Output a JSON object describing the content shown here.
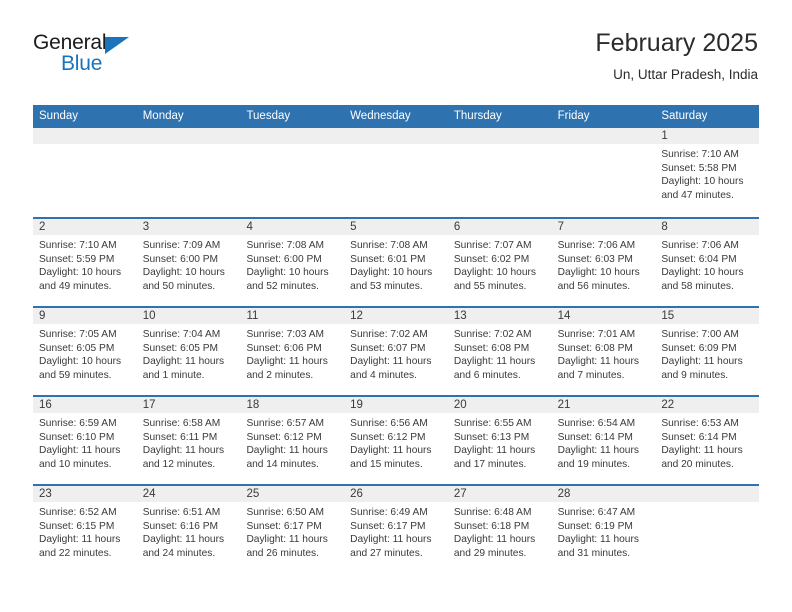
{
  "brand": {
    "name_part1": "General",
    "name_part2": "Blue",
    "triangle_color": "#1b73bb"
  },
  "header": {
    "title": "February 2025",
    "location": "Un, Uttar Pradesh, India"
  },
  "theme": {
    "header_blue": "#2e72b0",
    "day_head_gray": "#efefef",
    "text": "#3a3a3a"
  },
  "weekdays": [
    "Sunday",
    "Monday",
    "Tuesday",
    "Wednesday",
    "Thursday",
    "Friday",
    "Saturday"
  ],
  "weeks": [
    [
      {
        "date": "",
        "empty": true
      },
      {
        "date": "",
        "empty": true
      },
      {
        "date": "",
        "empty": true
      },
      {
        "date": "",
        "empty": true
      },
      {
        "date": "",
        "empty": true
      },
      {
        "date": "",
        "empty": true
      },
      {
        "date": "1",
        "sunrise": "Sunrise: 7:10 AM",
        "sunset": "Sunset: 5:58 PM",
        "daylight": "Daylight: 10 hours and 47 minutes."
      }
    ],
    [
      {
        "date": "2",
        "sunrise": "Sunrise: 7:10 AM",
        "sunset": "Sunset: 5:59 PM",
        "daylight": "Daylight: 10 hours and 49 minutes."
      },
      {
        "date": "3",
        "sunrise": "Sunrise: 7:09 AM",
        "sunset": "Sunset: 6:00 PM",
        "daylight": "Daylight: 10 hours and 50 minutes."
      },
      {
        "date": "4",
        "sunrise": "Sunrise: 7:08 AM",
        "sunset": "Sunset: 6:00 PM",
        "daylight": "Daylight: 10 hours and 52 minutes."
      },
      {
        "date": "5",
        "sunrise": "Sunrise: 7:08 AM",
        "sunset": "Sunset: 6:01 PM",
        "daylight": "Daylight: 10 hours and 53 minutes."
      },
      {
        "date": "6",
        "sunrise": "Sunrise: 7:07 AM",
        "sunset": "Sunset: 6:02 PM",
        "daylight": "Daylight: 10 hours and 55 minutes."
      },
      {
        "date": "7",
        "sunrise": "Sunrise: 7:06 AM",
        "sunset": "Sunset: 6:03 PM",
        "daylight": "Daylight: 10 hours and 56 minutes."
      },
      {
        "date": "8",
        "sunrise": "Sunrise: 7:06 AM",
        "sunset": "Sunset: 6:04 PM",
        "daylight": "Daylight: 10 hours and 58 minutes."
      }
    ],
    [
      {
        "date": "9",
        "sunrise": "Sunrise: 7:05 AM",
        "sunset": "Sunset: 6:05 PM",
        "daylight": "Daylight: 10 hours and 59 minutes."
      },
      {
        "date": "10",
        "sunrise": "Sunrise: 7:04 AM",
        "sunset": "Sunset: 6:05 PM",
        "daylight": "Daylight: 11 hours and 1 minute."
      },
      {
        "date": "11",
        "sunrise": "Sunrise: 7:03 AM",
        "sunset": "Sunset: 6:06 PM",
        "daylight": "Daylight: 11 hours and 2 minutes."
      },
      {
        "date": "12",
        "sunrise": "Sunrise: 7:02 AM",
        "sunset": "Sunset: 6:07 PM",
        "daylight": "Daylight: 11 hours and 4 minutes."
      },
      {
        "date": "13",
        "sunrise": "Sunrise: 7:02 AM",
        "sunset": "Sunset: 6:08 PM",
        "daylight": "Daylight: 11 hours and 6 minutes."
      },
      {
        "date": "14",
        "sunrise": "Sunrise: 7:01 AM",
        "sunset": "Sunset: 6:08 PM",
        "daylight": "Daylight: 11 hours and 7 minutes."
      },
      {
        "date": "15",
        "sunrise": "Sunrise: 7:00 AM",
        "sunset": "Sunset: 6:09 PM",
        "daylight": "Daylight: 11 hours and 9 minutes."
      }
    ],
    [
      {
        "date": "16",
        "sunrise": "Sunrise: 6:59 AM",
        "sunset": "Sunset: 6:10 PM",
        "daylight": "Daylight: 11 hours and 10 minutes."
      },
      {
        "date": "17",
        "sunrise": "Sunrise: 6:58 AM",
        "sunset": "Sunset: 6:11 PM",
        "daylight": "Daylight: 11 hours and 12 minutes."
      },
      {
        "date": "18",
        "sunrise": "Sunrise: 6:57 AM",
        "sunset": "Sunset: 6:12 PM",
        "daylight": "Daylight: 11 hours and 14 minutes."
      },
      {
        "date": "19",
        "sunrise": "Sunrise: 6:56 AM",
        "sunset": "Sunset: 6:12 PM",
        "daylight": "Daylight: 11 hours and 15 minutes."
      },
      {
        "date": "20",
        "sunrise": "Sunrise: 6:55 AM",
        "sunset": "Sunset: 6:13 PM",
        "daylight": "Daylight: 11 hours and 17 minutes."
      },
      {
        "date": "21",
        "sunrise": "Sunrise: 6:54 AM",
        "sunset": "Sunset: 6:14 PM",
        "daylight": "Daylight: 11 hours and 19 minutes."
      },
      {
        "date": "22",
        "sunrise": "Sunrise: 6:53 AM",
        "sunset": "Sunset: 6:14 PM",
        "daylight": "Daylight: 11 hours and 20 minutes."
      }
    ],
    [
      {
        "date": "23",
        "sunrise": "Sunrise: 6:52 AM",
        "sunset": "Sunset: 6:15 PM",
        "daylight": "Daylight: 11 hours and 22 minutes."
      },
      {
        "date": "24",
        "sunrise": "Sunrise: 6:51 AM",
        "sunset": "Sunset: 6:16 PM",
        "daylight": "Daylight: 11 hours and 24 minutes."
      },
      {
        "date": "25",
        "sunrise": "Sunrise: 6:50 AM",
        "sunset": "Sunset: 6:17 PM",
        "daylight": "Daylight: 11 hours and 26 minutes."
      },
      {
        "date": "26",
        "sunrise": "Sunrise: 6:49 AM",
        "sunset": "Sunset: 6:17 PM",
        "daylight": "Daylight: 11 hours and 27 minutes."
      },
      {
        "date": "27",
        "sunrise": "Sunrise: 6:48 AM",
        "sunset": "Sunset: 6:18 PM",
        "daylight": "Daylight: 11 hours and 29 minutes."
      },
      {
        "date": "28",
        "sunrise": "Sunrise: 6:47 AM",
        "sunset": "Sunset: 6:19 PM",
        "daylight": "Daylight: 11 hours and 31 minutes."
      },
      {
        "date": "",
        "empty": true
      }
    ]
  ]
}
